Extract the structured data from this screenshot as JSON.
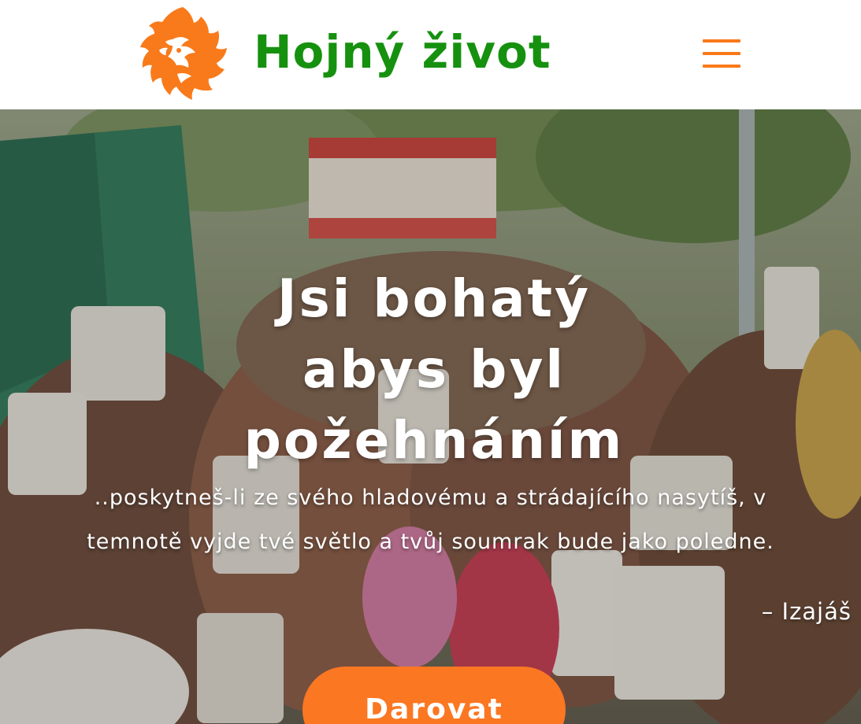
{
  "header": {
    "logo_icon": "lion-head-icon",
    "site_title": "Hojný život",
    "menu_icon": "hamburger-menu-icon"
  },
  "colors": {
    "brand_green": "#16910f",
    "accent_orange": "#f97a1a",
    "button_orange": "#fb7722"
  },
  "hero": {
    "headline_lines": [
      "Jsi bohatý",
      "abys byl",
      "požehnáním"
    ],
    "quote_lines": [
      "..poskytneš-li ze svého hladovému a strádajícího nasytíš, v",
      "temnotě vyjde tvé světlo a tvůj soumrak bude jako poledne."
    ],
    "attribution": "– Izajáš",
    "donate_label": "Darovat"
  }
}
